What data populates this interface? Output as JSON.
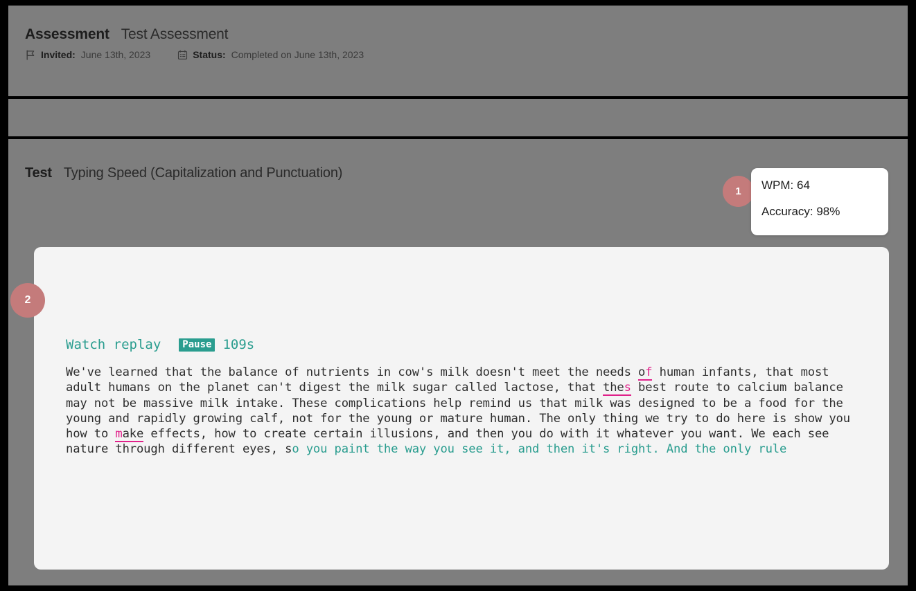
{
  "header": {
    "label": "Assessment",
    "name": "Test Assessment",
    "invited": {
      "icon": "flag-icon",
      "label": "Invited:",
      "value": "June 13th, 2023"
    },
    "status": {
      "icon": "calendar-checklist-icon",
      "label": "Status:",
      "value": "Completed on June 13th, 2023"
    }
  },
  "test": {
    "label": "Test",
    "name": "Typing Speed (Capitalization and Punctuation)"
  },
  "stats": {
    "marker": "1",
    "wpm": "WPM: 64",
    "accuracy": "Accuracy: 98%"
  },
  "replay": {
    "marker": "2",
    "watch_label": "Watch replay",
    "pause_label": "Pause",
    "elapsed": "109s"
  },
  "passage": {
    "segments": [
      {
        "text": "We've learned that the balance of nutrients in cow's milk doesn't meet the needs ",
        "state": "correct"
      },
      {
        "text": "o",
        "state": "error"
      },
      {
        "text": "f",
        "state": "error-char"
      },
      {
        "text": " human infants, that most adult humans on the planet can't digest the milk sugar called lactose, that ",
        "state": "correct"
      },
      {
        "text": "the",
        "state": "error"
      },
      {
        "text": "s",
        "state": "error-char"
      },
      {
        "text": " best route to calcium balance may not be massive milk intake. These complications help remind us that milk was designed to be a food for the young and rapidly growing calf, not for the young or mature human. The only thing we try to do here is show you how to ",
        "state": "correct"
      },
      {
        "text": "m",
        "state": "error-char"
      },
      {
        "text": "ake",
        "state": "error"
      },
      {
        "text": " effects, how to create certain illusions, and then you do with it whatever you want. We each see nature through different eyes, s",
        "state": "correct"
      },
      {
        "text": "o you paint the way you see it, and then it's right. And the only rule",
        "state": "pending"
      }
    ]
  },
  "colors": {
    "accent_teal": "#2a9d8f",
    "error_pink": "#e0218a",
    "marker_rose": "#c47b7b",
    "page_background": "#7e7e7e",
    "card_background": "#f4f4f4"
  }
}
